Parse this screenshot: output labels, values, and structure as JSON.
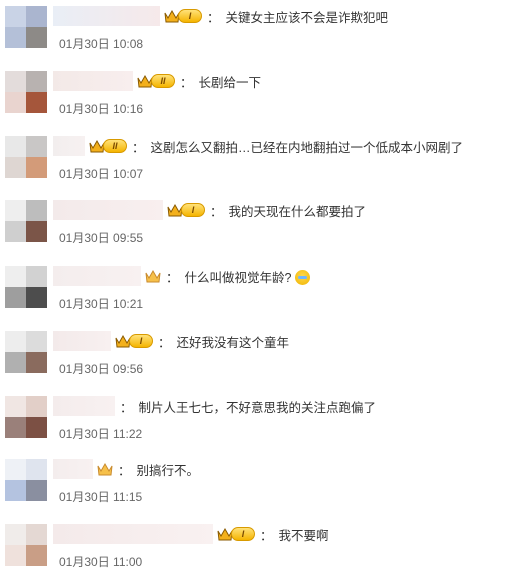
{
  "colon": "：",
  "level_labels": {
    "I": "I",
    "II": "II"
  },
  "comments": [
    {
      "text": "关键女主应该不会是诈欺犯吧",
      "time": "01月30日 10:08",
      "level": "I"
    },
    {
      "text": "长剧给一下",
      "time": "01月30日 10:16",
      "level": "II"
    },
    {
      "text": "这剧怎么又翻拍…已经在内地翻拍过一个低成本小网剧了",
      "time": "01月30日 10:07",
      "level": "II"
    },
    {
      "text": "我的天现在什么都要拍了",
      "time": "01月30日 09:55",
      "level": "I"
    },
    {
      "text": "什么叫做视觉年龄?",
      "time": "01月30日 10:21",
      "level": ""
    },
    {
      "text": "还好我没有这个童年",
      "time": "01月30日 09:56",
      "level": "I"
    },
    {
      "text": "制片人王七七，不好意思我的关注点跑偏了",
      "time": "01月30日 11:22",
      "level": ""
    },
    {
      "text": "别搞行不。",
      "time": "01月30日 11:15",
      "level": ""
    },
    {
      "text": "我不要啊",
      "time": "01月30日 11:00",
      "level": "I"
    }
  ],
  "icons": {
    "crown": "crown-icon",
    "emoji": "crying-laughing-emoji-icon"
  },
  "colors": {
    "text": "#333333",
    "time": "#666666",
    "badge_gold": "#f5b400"
  }
}
